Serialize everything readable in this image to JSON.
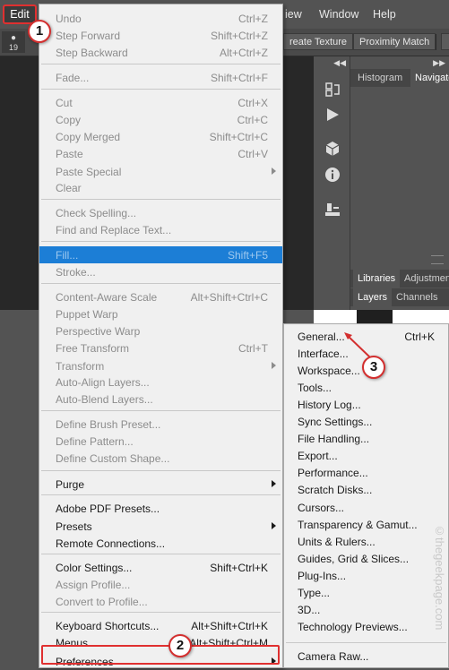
{
  "menubar": {
    "edit": "Edit",
    "view_partial": "iew",
    "window": "Window",
    "help": "Help"
  },
  "options_bar": {
    "brush_size": "19",
    "create_texture_partial": "reate Texture",
    "proximity_match": "Proximity Match"
  },
  "panels": {
    "tabs_top": [
      "Histogram",
      "Navigato"
    ],
    "tabs_mid": [
      "Libraries",
      "Adjustmen"
    ],
    "tabs_bottom": [
      "Layers",
      "Channels"
    ],
    "tool_icons": [
      "history-icon",
      "play-icon",
      "3d-cube-icon",
      "info-icon",
      "clone-source-icon"
    ]
  },
  "edit_menu": {
    "items": [
      {
        "label": "Undo",
        "shortcut": "Ctrl+Z",
        "disabled": true
      },
      {
        "label": "Step Forward",
        "shortcut": "Shift+Ctrl+Z",
        "disabled": true
      },
      {
        "label": "Step Backward",
        "shortcut": "Alt+Ctrl+Z",
        "disabled": true
      },
      {
        "label": "Fade...",
        "shortcut": "Shift+Ctrl+F",
        "disabled": true
      },
      {
        "label": "Cut",
        "shortcut": "Ctrl+X",
        "disabled": true
      },
      {
        "label": "Copy",
        "shortcut": "Ctrl+C",
        "disabled": true
      },
      {
        "label": "Copy Merged",
        "shortcut": "Shift+Ctrl+C",
        "disabled": true
      },
      {
        "label": "Paste",
        "shortcut": "Ctrl+V",
        "disabled": true
      },
      {
        "label": "Paste Special",
        "shortcut": "",
        "disabled": true
      },
      {
        "label": "Clear",
        "shortcut": "",
        "disabled": true
      },
      {
        "label": "Check Spelling...",
        "shortcut": "",
        "disabled": true
      },
      {
        "label": "Find and Replace Text...",
        "shortcut": "",
        "disabled": true
      },
      {
        "label": "Fill...",
        "shortcut": "Shift+F5",
        "disabled": true
      },
      {
        "label": "Stroke...",
        "shortcut": "",
        "disabled": true
      },
      {
        "label": "Content-Aware Scale",
        "shortcut": "Alt+Shift+Ctrl+C",
        "disabled": true
      },
      {
        "label": "Puppet Warp",
        "shortcut": "",
        "disabled": true
      },
      {
        "label": "Perspective Warp",
        "shortcut": "",
        "disabled": true
      },
      {
        "label": "Free Transform",
        "shortcut": "Ctrl+T",
        "disabled": true
      },
      {
        "label": "Transform",
        "shortcut": "",
        "disabled": true
      },
      {
        "label": "Auto-Align Layers...",
        "shortcut": "",
        "disabled": true
      },
      {
        "label": "Auto-Blend Layers...",
        "shortcut": "",
        "disabled": true
      },
      {
        "label": "Define Brush Preset...",
        "shortcut": "",
        "disabled": true
      },
      {
        "label": "Define Pattern...",
        "shortcut": "",
        "disabled": true
      },
      {
        "label": "Define Custom Shape...",
        "shortcut": "",
        "disabled": true
      },
      {
        "label": "Purge",
        "shortcut": "",
        "disabled": false
      },
      {
        "label": "Adobe PDF Presets...",
        "shortcut": "",
        "disabled": false
      },
      {
        "label": "Presets",
        "shortcut": "",
        "disabled": false
      },
      {
        "label": "Remote Connections...",
        "shortcut": "",
        "disabled": false
      },
      {
        "label": "Color Settings...",
        "shortcut": "Shift+Ctrl+K",
        "disabled": false
      },
      {
        "label": "Assign Profile...",
        "shortcut": "",
        "disabled": true
      },
      {
        "label": "Convert to Profile...",
        "shortcut": "",
        "disabled": true
      },
      {
        "label": "Keyboard Shortcuts...",
        "shortcut": "Alt+Shift+Ctrl+K",
        "disabled": false
      },
      {
        "label": "Menus...",
        "shortcut": "Alt+Shift+Ctrl+M",
        "disabled": false
      },
      {
        "label": "Preferences",
        "shortcut": "",
        "disabled": false
      }
    ]
  },
  "preferences_submenu": {
    "items": [
      {
        "label": "General...",
        "shortcut": "Ctrl+K"
      },
      {
        "label": "Interface...",
        "shortcut": ""
      },
      {
        "label": "Workspace...",
        "shortcut": ""
      },
      {
        "label": "Tools...",
        "shortcut": ""
      },
      {
        "label": "History Log...",
        "shortcut": ""
      },
      {
        "label": "Sync Settings...",
        "shortcut": ""
      },
      {
        "label": "File Handling...",
        "shortcut": ""
      },
      {
        "label": "Export...",
        "shortcut": ""
      },
      {
        "label": "Performance...",
        "shortcut": ""
      },
      {
        "label": "Scratch Disks...",
        "shortcut": ""
      },
      {
        "label": "Cursors...",
        "shortcut": ""
      },
      {
        "label": "Transparency & Gamut...",
        "shortcut": ""
      },
      {
        "label": "Units & Rulers...",
        "shortcut": ""
      },
      {
        "label": "Guides, Grid & Slices...",
        "shortcut": ""
      },
      {
        "label": "Plug-Ins...",
        "shortcut": ""
      },
      {
        "label": "Type...",
        "shortcut": ""
      },
      {
        "label": "3D...",
        "shortcut": ""
      },
      {
        "label": "Technology Previews...",
        "shortcut": ""
      },
      {
        "label": "Camera Raw...",
        "shortcut": ""
      }
    ]
  },
  "callouts": [
    "1",
    "2",
    "3"
  ],
  "watermark": "©thegeekpage.com",
  "colors": {
    "highlight": "#1c7ed6",
    "callout_border": "#d32f2f",
    "menu_bg": "#f0f0f0"
  }
}
